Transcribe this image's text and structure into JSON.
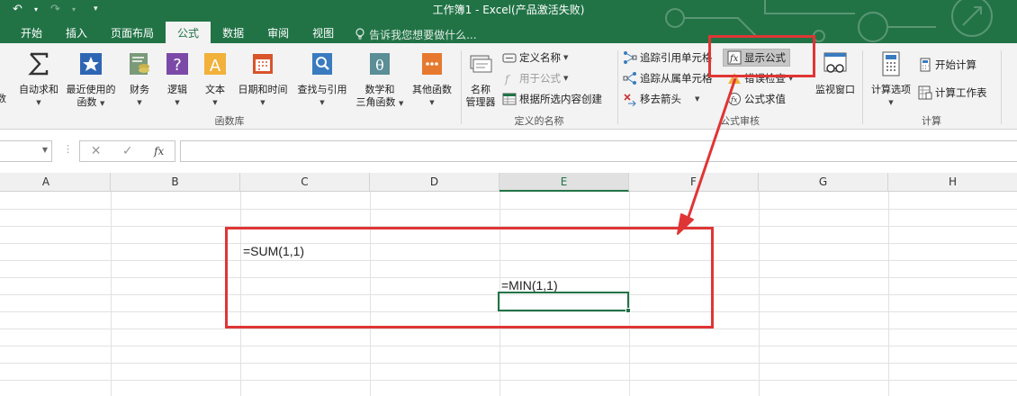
{
  "quick_access": {
    "undo_icon": "undo-icon",
    "redo_icon": "redo-icon",
    "customize": "▾"
  },
  "window": {
    "title": "工作簿1 - Excel(产品激活失败)"
  },
  "tabs": [
    {
      "label": "开始",
      "active": false
    },
    {
      "label": "插入",
      "active": false
    },
    {
      "label": "页面布局",
      "active": false
    },
    {
      "label": "公式",
      "active": true
    },
    {
      "label": "数据",
      "active": false
    },
    {
      "label": "审阅",
      "active": false
    },
    {
      "label": "视图",
      "active": false
    }
  ],
  "tell_me": {
    "placeholder": "告诉我您想要做什么...",
    "icon": "lightbulb-icon"
  },
  "ribbon": {
    "function_library": {
      "label": "函数库",
      "first_partial": "数",
      "buttons": [
        {
          "label": "自动求和",
          "icon": "sigma-icon"
        },
        {
          "label": "最近使用的",
          "label2": "函数",
          "icon": "star-icon"
        },
        {
          "label": "财务",
          "icon": "finance-icon"
        },
        {
          "label": "逻辑",
          "icon": "logic-icon"
        },
        {
          "label": "文本",
          "icon": "text-icon"
        },
        {
          "label": "日期和时间",
          "icon": "calendar-icon"
        },
        {
          "label": "查找与引用",
          "icon": "lookup-icon"
        },
        {
          "label": "数学和",
          "label2": "三角函数",
          "icon": "math-icon"
        },
        {
          "label": "其他函数",
          "icon": "more-functions-icon"
        }
      ]
    },
    "defined_names": {
      "label": "定义的名称",
      "name_manager": {
        "label": "名称",
        "label2": "管理器"
      },
      "define_name": "定义名称",
      "use_in_formula": "用于公式",
      "create_from_selection": "根据所选内容创建"
    },
    "formula_auditing": {
      "label": "公式审核",
      "trace_precedents": "追踪引用单元格",
      "trace_dependents": "追踪从属单元格",
      "remove_arrows": "移去箭头",
      "show_formulas": "显示公式",
      "error_checking": "错误检查",
      "evaluate_formula": "公式求值",
      "watch_window": "监视窗口"
    },
    "calculation": {
      "label": "计算",
      "calc_options": "计算选项",
      "calc_now": "开始计算",
      "calc_sheet": "计算工作表"
    }
  },
  "formula_bar": {
    "cancel": "✕",
    "enter": "✓",
    "fx": "fx",
    "value": ""
  },
  "columns": [
    "A",
    "B",
    "C",
    "D",
    "E",
    "F",
    "G",
    "H"
  ],
  "active_column": "E",
  "cells": {
    "C3": "=SUM(1,1)",
    "E4": "=MIN(1,1)"
  },
  "colors": {
    "excel_green": "#217346",
    "annotation_red": "#e03535"
  }
}
